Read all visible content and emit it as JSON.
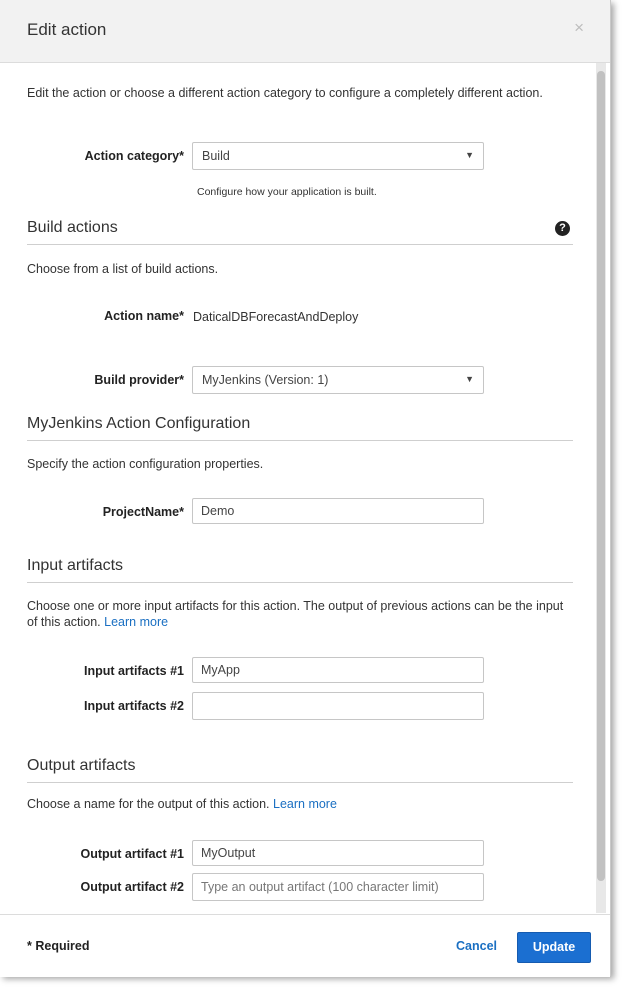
{
  "dialog": {
    "title": "Edit action",
    "close_symbol": "×"
  },
  "intro": {
    "text": "Edit the action or choose a different action category to configure a completely different action."
  },
  "action_category": {
    "label": "Action category*",
    "value": "Build",
    "hint": "Configure how your application is built."
  },
  "build_actions": {
    "heading": "Build actions",
    "help_symbol": "?",
    "description": "Choose from a list of build actions.",
    "action_name_label": "Action name*",
    "action_name_value": "DaticalDBForecastAndDeploy",
    "build_provider_label": "Build provider*",
    "build_provider_value": "MyJenkins (Version: 1)"
  },
  "config": {
    "heading": "MyJenkins Action Configuration",
    "description": "Specify the action configuration properties.",
    "project_name_label": "ProjectName*",
    "project_name_value": "Demo"
  },
  "input_artifacts": {
    "heading": "Input artifacts",
    "description": "Choose one or more input artifacts for this action. The output of previous actions can be the input of this action.",
    "learn_more": "Learn more",
    "items": [
      {
        "label": "Input artifacts #1",
        "value": "MyApp"
      },
      {
        "label": "Input artifacts #2",
        "value": ""
      }
    ]
  },
  "output_artifacts": {
    "heading": "Output artifacts",
    "description": "Choose a name for the output of this action.",
    "learn_more": "Learn more",
    "items": [
      {
        "label": "Output artifact #1",
        "value": "MyOutput",
        "placeholder": ""
      },
      {
        "label": "Output artifact #2",
        "value": "",
        "placeholder": "Type an output artifact (100 character limit)"
      }
    ]
  },
  "footer": {
    "required_note": "* Required",
    "cancel_label": "Cancel",
    "update_label": "Update"
  },
  "colors": {
    "accent": "#1b6fd1",
    "link": "#1a6fc2",
    "header_bg": "#f2f2f2"
  }
}
